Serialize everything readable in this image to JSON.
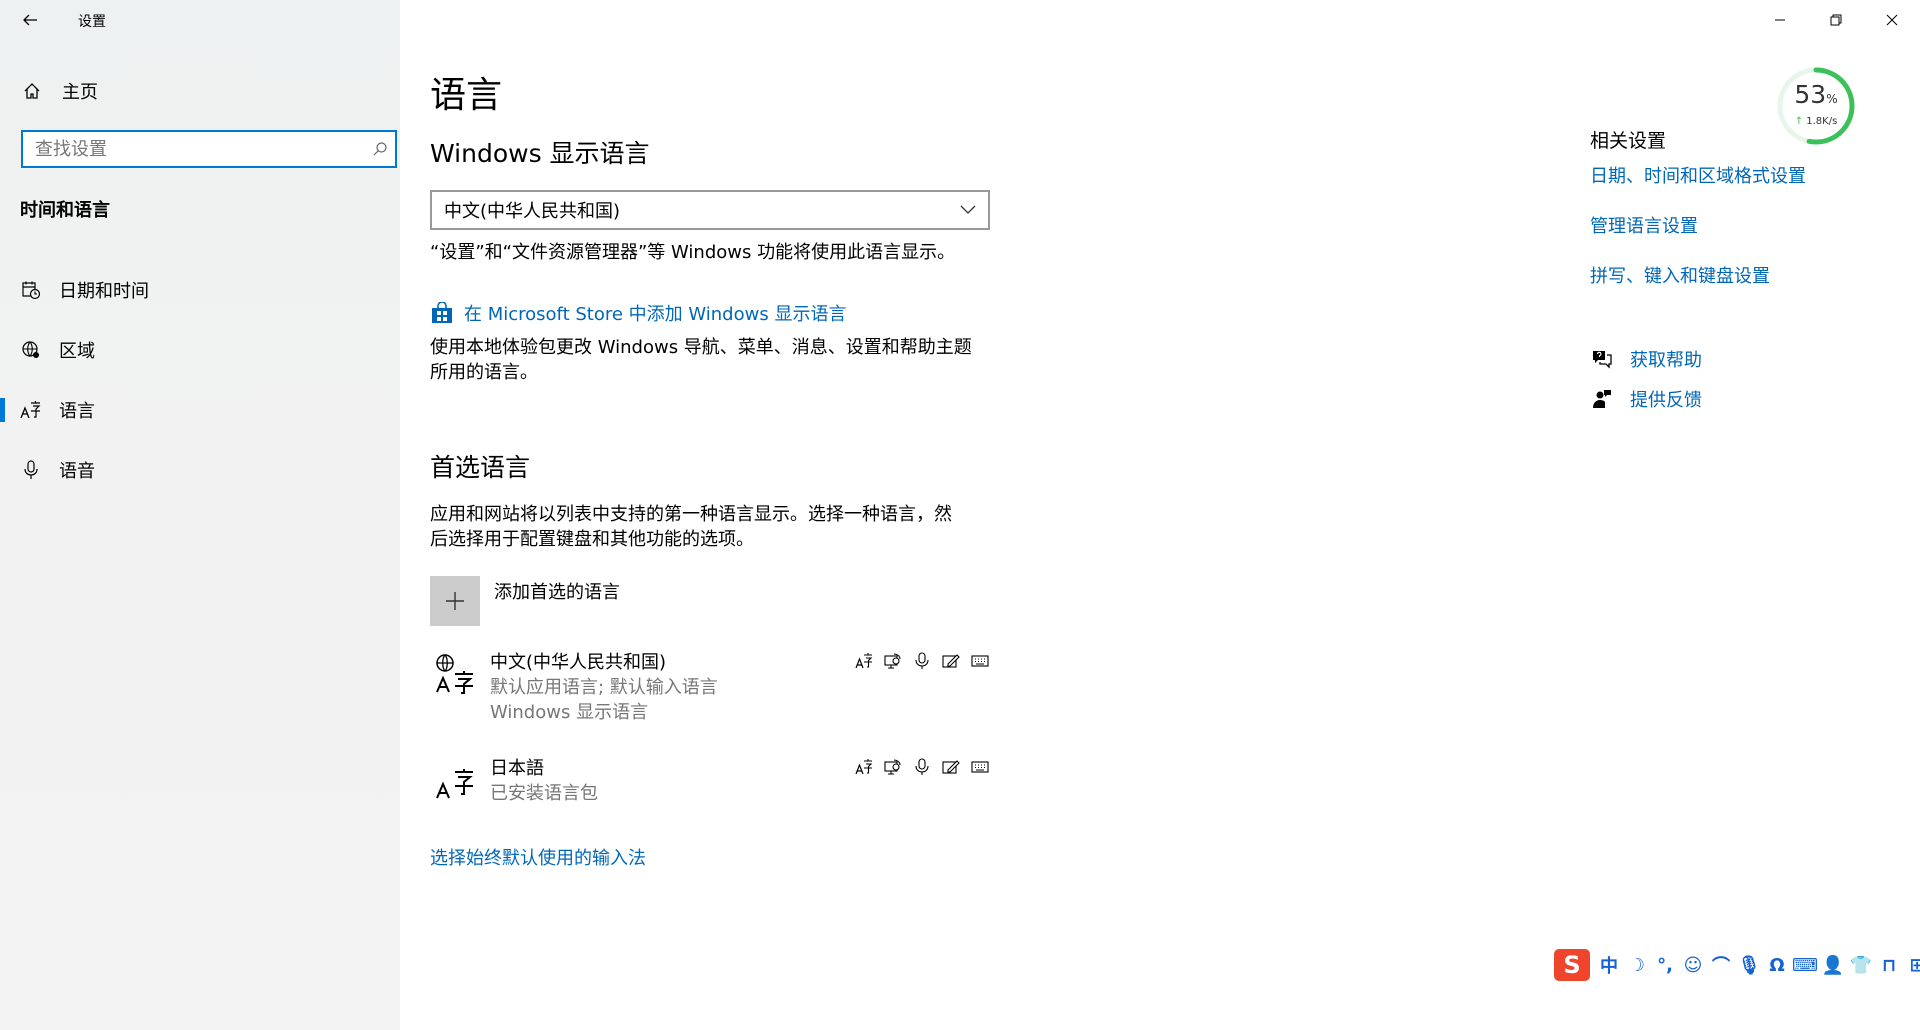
{
  "window": {
    "title": "设置",
    "controls": [
      "minimize",
      "restore",
      "close"
    ]
  },
  "sidebar": {
    "home_label": "主页",
    "search_placeholder": "查找设置",
    "section_title": "时间和语言",
    "items": [
      {
        "label": "日期和时间",
        "icon": "calendar-clock-icon",
        "active": false
      },
      {
        "label": "区域",
        "icon": "globe-region-icon",
        "active": false
      },
      {
        "label": "语言",
        "icon": "language-icon",
        "active": true
      },
      {
        "label": "语音",
        "icon": "microphone-icon",
        "active": false
      }
    ]
  },
  "main": {
    "title": "语言",
    "display_language": {
      "heading": "Windows 显示语言",
      "selected": "中文(中华人民共和国)",
      "note": "“设置”和“文件资源管理器”等 Windows 功能将使用此语言显示。",
      "store_link": "在 Microsoft Store 中添加 Windows 显示语言",
      "store_desc_line1": "使用本地体验包更改 Windows 导航、菜单、消息、设置和帮助主题",
      "store_desc_line2": "所用的语言。"
    },
    "preferred": {
      "heading": "首选语言",
      "desc_line1": "应用和网站将以列表中支持的第一种语言显示。选择一种语言，然",
      "desc_line2": "后选择用于配置键盘和其他功能的选项。",
      "add_label": "添加首选的语言",
      "languages": [
        {
          "name": "中文(中华人民共和国)",
          "sub1": "默认应用语言; 默认输入语言",
          "sub2": "Windows 显示语言"
        },
        {
          "name": "日本語",
          "sub1": "已安装语言包",
          "sub2": ""
        }
      ],
      "feature_icons": [
        "display-language-icon",
        "text-to-speech-icon",
        "speech-icon",
        "handwriting-icon",
        "keyboard-icon"
      ]
    },
    "input_method_link": "选择始终默认使用的输入法"
  },
  "related": {
    "title": "相关设置",
    "links": [
      "日期、时间和区域格式设置",
      "管理语言设置",
      "拼写、键入和键盘设置"
    ],
    "help": "获取帮助",
    "feedback": "提供反馈"
  },
  "network_widget": {
    "percent": "53",
    "percent_unit": "%",
    "rate": "1.8K/s",
    "percent_value": 53,
    "color": "#3cc15a"
  },
  "ime_toolbar": {
    "logo": "S",
    "mode": "中",
    "icons": [
      "moon-icon",
      "punctuation-icon",
      "emoji-icon",
      "skin-icon",
      "microphone-icon",
      "headset-icon",
      "keyboard-icon",
      "user-icon",
      "shirt-icon",
      "tool-icon",
      "grid-icon"
    ]
  },
  "colors": {
    "accent": "#0078d7",
    "link": "#0067b8",
    "sidebar_bg": "#f2f2f2"
  }
}
